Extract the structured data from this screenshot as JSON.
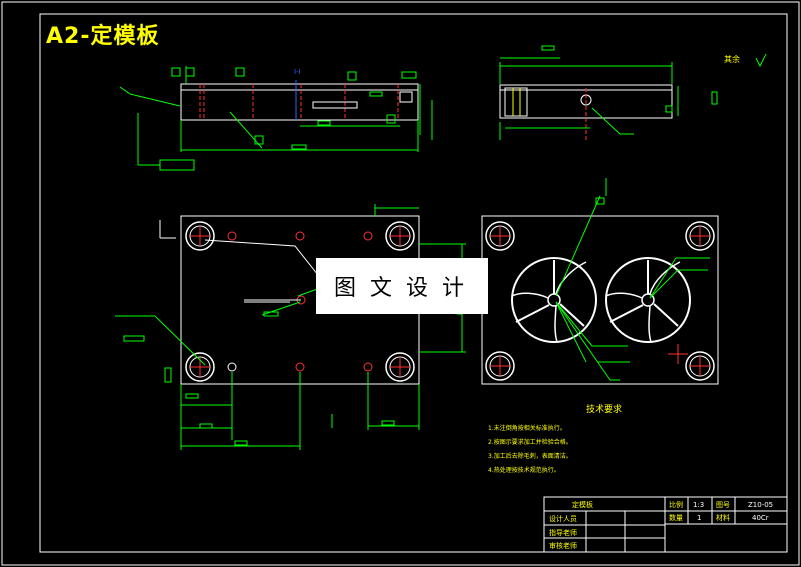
{
  "drawing": {
    "title": "A2-定模板",
    "watermark": "图文设计",
    "roughness_note": "其余",
    "tech_requirements": {
      "heading": "技术要求",
      "items": [
        "1.未注倒角按相关标准执行。",
        "2.按图示要求加工并检验合格。",
        "3.加工后去除毛刺，表面清洁。",
        "4.热处理按技术规范执行。"
      ]
    },
    "title_block": {
      "part_name": "定模板",
      "scale_label": "比例",
      "scale_value": "1:3",
      "drawing_no_label": "图号",
      "drawing_no": "Z10-05",
      "quantity_label": "数量",
      "quantity_value": "1",
      "material_label": "材料",
      "material_value": "40Cr",
      "row2_label": "设计人员",
      "row3_label": "指导老师",
      "row4_label": "审核老师"
    }
  }
}
